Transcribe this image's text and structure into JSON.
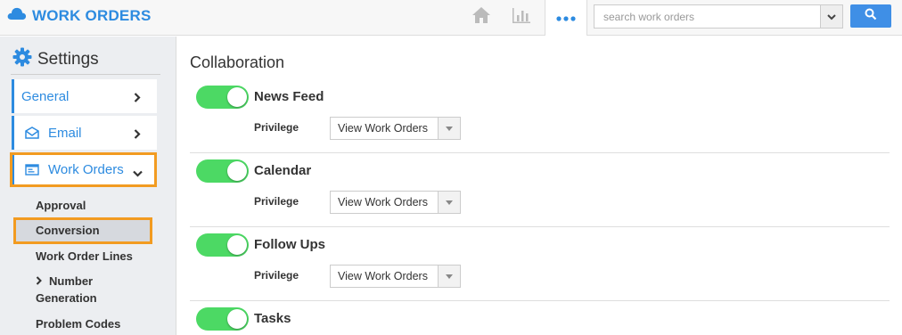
{
  "header": {
    "app_title": "WORK ORDERS",
    "search": {
      "placeholder": "search work orders"
    },
    "icons": [
      "cloud-icon",
      "home-icon",
      "bar-chart-icon",
      "more-icon",
      "chevron-down-icon",
      "search-icon"
    ],
    "accent_color": "#2d8be0"
  },
  "sidebar": {
    "heading": "Settings",
    "items": [
      {
        "label": "General"
      },
      {
        "label": "Email"
      },
      {
        "label": "Work Orders"
      }
    ],
    "sub_items": [
      {
        "label": "Approval"
      },
      {
        "label": "Conversion"
      },
      {
        "label": "Work Order Lines"
      },
      {
        "label": "Number"
      },
      {
        "label": "Generation"
      },
      {
        "label": "Problem Codes"
      }
    ],
    "highlight_color": "#f29b21"
  },
  "main": {
    "title": "Collaboration",
    "sections": [
      {
        "label": "News Feed",
        "enabled": true,
        "privilege_label": "Privilege",
        "privilege_value": "View Work Orders"
      },
      {
        "label": "Calendar",
        "enabled": true,
        "privilege_label": "Privilege",
        "privilege_value": "View Work Orders"
      },
      {
        "label": "Follow Ups",
        "enabled": true,
        "privilege_label": "Privilege",
        "privilege_value": "View Work Orders"
      },
      {
        "label": "Tasks",
        "enabled": true
      }
    ],
    "toggle_color": "#4cd964"
  }
}
